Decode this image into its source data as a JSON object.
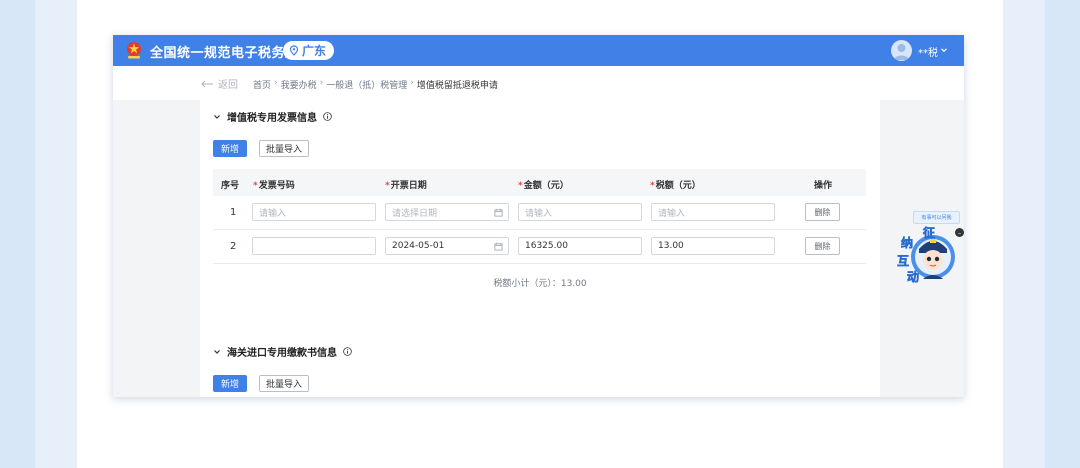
{
  "header": {
    "title": "全国统一规范电子税务局",
    "region": "广东",
    "user": "**税"
  },
  "breadcrumb": {
    "back": "返回",
    "items": [
      "首页",
      "我要办税",
      "一般退（抵）税管理",
      "增值税留抵退税申请"
    ]
  },
  "section1": {
    "title": "增值税专用发票信息",
    "add_label": "新增",
    "import_label": "批量导入",
    "columns": [
      "序号",
      "发票号码",
      "开票日期",
      "金额（元）",
      "税额（元）",
      "操作"
    ],
    "rows": [
      {
        "index": "1",
        "invoice_no": "",
        "invoice_no_ph": "请输入",
        "date": "",
        "date_ph": "请选择日期",
        "amount": "",
        "amount_ph": "请输入",
        "tax": "",
        "tax_ph": "请输入",
        "action": "删除"
      },
      {
        "index": "2",
        "invoice_no": "",
        "invoice_no_ph": "",
        "date": "2024-05-01",
        "date_ph": "",
        "amount": "16325.00",
        "amount_ph": "",
        "tax": "13.00",
        "tax_ph": "",
        "action": "删除"
      }
    ],
    "subtotal": "税额小计（元）：13.00"
  },
  "section2": {
    "title": "海关进口专用缴款书信息",
    "add_label": "新增",
    "import_label": "批量导入"
  },
  "mascot": {
    "tip": "有事可以问我",
    "label_chars": [
      "征",
      "纳",
      "互",
      "动"
    ]
  },
  "colors": {
    "primary": "#3f81e6",
    "required": "#e5484d",
    "page_bg": "#c9dcf3"
  }
}
